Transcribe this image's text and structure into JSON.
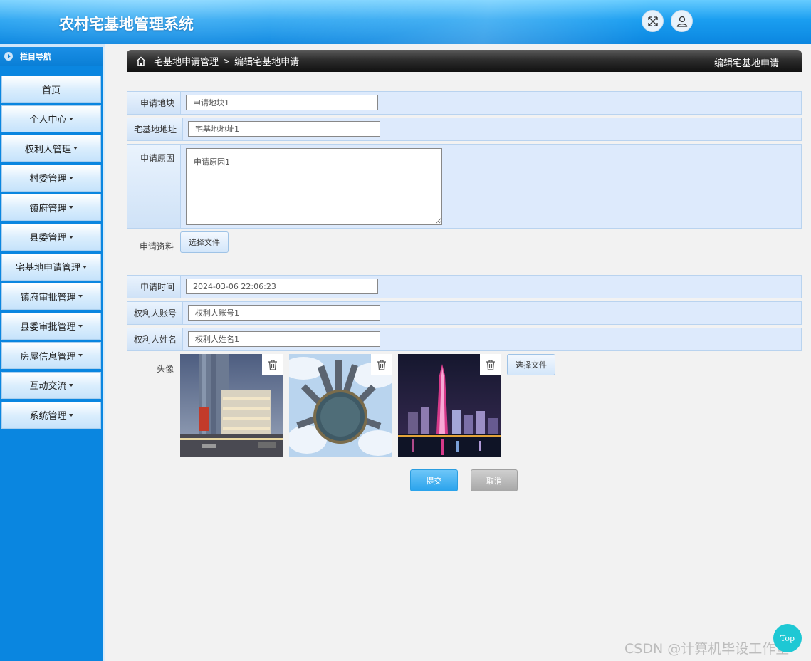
{
  "app": {
    "title": "农村宅基地管理系统"
  },
  "header": {
    "fullscreen_icon": "fullscreen-icon",
    "user_icon": "user-icon"
  },
  "sidebar": {
    "title": "栏目导航",
    "items": [
      {
        "label": "首页",
        "has_caret": false
      },
      {
        "label": "个人中心",
        "has_caret": true
      },
      {
        "label": "权利人管理",
        "has_caret": true
      },
      {
        "label": "村委管理",
        "has_caret": true
      },
      {
        "label": "镇府管理",
        "has_caret": true
      },
      {
        "label": "县委管理",
        "has_caret": true
      },
      {
        "label": "宅基地申请管理",
        "has_caret": true
      },
      {
        "label": "镇府审批管理",
        "has_caret": true
      },
      {
        "label": "县委审批管理",
        "has_caret": true
      },
      {
        "label": "房屋信息管理",
        "has_caret": true
      },
      {
        "label": "互动交流",
        "has_caret": true
      },
      {
        "label": "系统管理",
        "has_caret": true
      }
    ]
  },
  "breadcrumb": {
    "parent": "宅基地申请管理",
    "separator": ">",
    "current": "编辑宅基地申请",
    "right_title": "编辑宅基地申请"
  },
  "form": {
    "plot": {
      "label": "申请地块",
      "value": "申请地块1"
    },
    "address": {
      "label": "宅基地地址",
      "value": "宅基地地址1"
    },
    "reason": {
      "label": "申请原因",
      "value": "申请原因1"
    },
    "materials": {
      "label": "申请资料",
      "button": "选择文件"
    },
    "time": {
      "label": "申请时间",
      "value": "2024-03-06 22:06:23"
    },
    "account": {
      "label": "权利人账号",
      "value": "权利人账号1"
    },
    "name": {
      "label": "权利人姓名",
      "value": "权利人姓名1"
    },
    "avatar": {
      "label": "头像",
      "button": "选择文件",
      "image_count": 3
    },
    "submit": "提交",
    "cancel": "取消"
  },
  "top_button": "Top",
  "watermark": "CSDN @计算机毕设工作室",
  "colors": {
    "sidebar": "#0a86e0",
    "header": "#1a9ef0",
    "submit": "#2aa3ec",
    "cancel": "#a8a8a8"
  }
}
